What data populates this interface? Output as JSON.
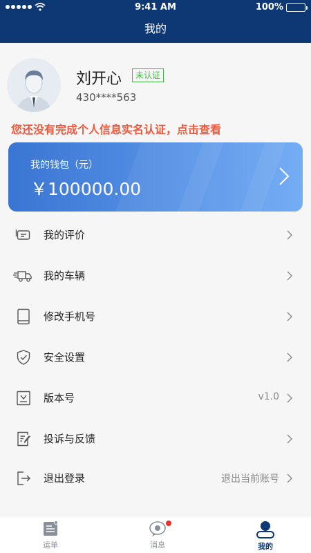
{
  "status_bar": {
    "time": "9:41 AM",
    "battery": "100%"
  },
  "nav": {
    "title": "我的"
  },
  "profile": {
    "name": "刘开心",
    "badge": "未认证",
    "phone": "430****563",
    "warning": "您还没有完成个人信息实名认证，点击查看"
  },
  "wallet": {
    "label": "我的钱包（元）",
    "amount": "￥100000.00"
  },
  "menu": [
    {
      "label": "我的评价",
      "icon": "comment-icon",
      "extra": ""
    },
    {
      "label": "我的车辆",
      "icon": "truck-icon",
      "extra": ""
    },
    {
      "label": "修改手机号",
      "icon": "phone-icon",
      "extra": ""
    },
    {
      "label": "安全设置",
      "icon": "shield-icon",
      "extra": ""
    },
    {
      "label": "版本号",
      "icon": "download-icon",
      "extra": "v1.0"
    },
    {
      "label": "投诉与反馈",
      "icon": "feedback-icon",
      "extra": ""
    },
    {
      "label": "退出登录",
      "icon": "logout-icon",
      "extra": "退出当前账号"
    }
  ],
  "tabs": [
    {
      "label": "运单",
      "icon": "waybill-icon"
    },
    {
      "label": "消息",
      "icon": "message-icon"
    },
    {
      "label": "我的",
      "icon": "user-icon"
    }
  ],
  "colors": {
    "primary": "#0e3873",
    "warning": "#f0583c",
    "badge": "#49b44a",
    "wallet_start": "#3a75d3",
    "wallet_end": "#6ca8f4"
  }
}
